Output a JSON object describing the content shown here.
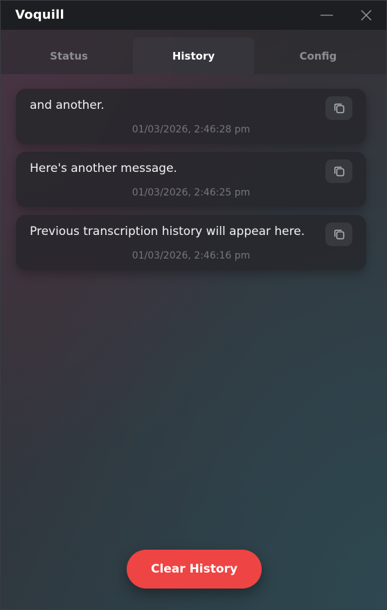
{
  "app": {
    "title": "Voquill"
  },
  "window_controls": {
    "minimize_icon": "minimize-icon",
    "close_icon": "close-icon"
  },
  "tabs": [
    {
      "label": "Status",
      "active": false
    },
    {
      "label": "History",
      "active": true
    },
    {
      "label": "Config",
      "active": false
    }
  ],
  "history": {
    "items": [
      {
        "text": "and another.",
        "timestamp": "01/03/2026, 2:46:28 pm",
        "icon": "copy-icon"
      },
      {
        "text": "Here's another message.",
        "timestamp": "01/03/2026, 2:46:25 pm",
        "icon": "copy-icon"
      },
      {
        "text": "Previous transcription history will appear here.",
        "timestamp": "01/03/2026, 2:46:16 pm",
        "icon": "copy-icon"
      }
    ]
  },
  "actions": {
    "clear_label": "Clear History"
  },
  "colors": {
    "accent": "#ee4444",
    "titlebar": "#1d1e22",
    "card": "#26262b"
  }
}
